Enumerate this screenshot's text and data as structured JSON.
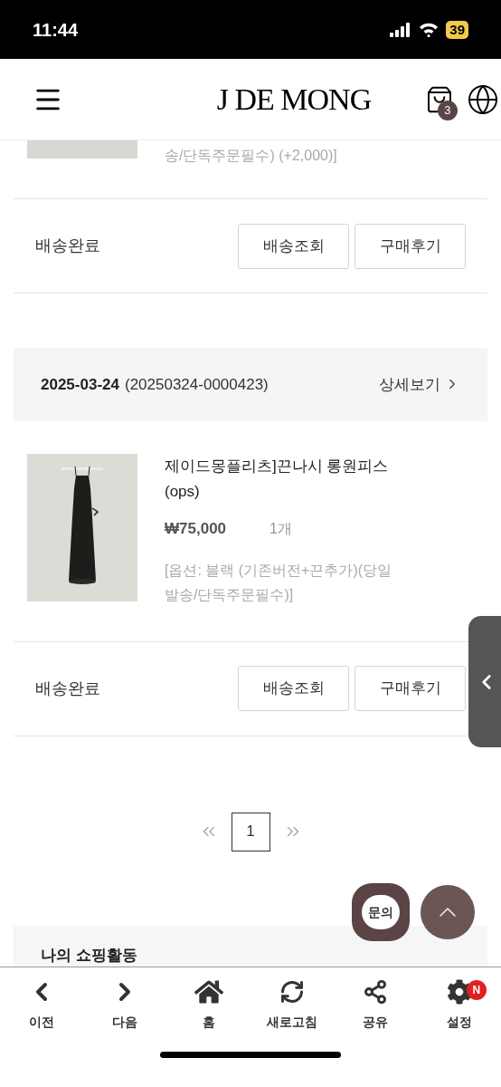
{
  "status_bar": {
    "time": "11:44",
    "battery": "39"
  },
  "header": {
    "logo": "J DE MONG",
    "cart_count": "3"
  },
  "previous_order": {
    "option_tail": "송/단독주문필수) (+2,000)]",
    "status": "배송완료",
    "buttons": [
      "배송조회",
      "구매후기"
    ]
  },
  "order": {
    "date": "2025-03-24",
    "number": "(20250324-0000423)",
    "detail_link": "상세보기",
    "product": {
      "name": "제이드몽플리츠]끈나시 롱원피스 (ops)",
      "price": "₩75,000",
      "quantity": "1개",
      "option": "[옵션: 블랙 (기존버전+끈추가)(당일 발송/단독주문필수)]"
    },
    "status": "배송완료",
    "buttons": [
      "배송조회",
      "구매후기"
    ]
  },
  "pagination": {
    "pages": [
      {
        "label": "1",
        "selected": true
      }
    ]
  },
  "inquiry_button": "문의",
  "section_title": "나의 쇼핑활동",
  "bottom_nav": [
    {
      "label": "이전",
      "kind": "back"
    },
    {
      "label": "다음",
      "kind": "forward"
    },
    {
      "label": "홈",
      "kind": "home"
    },
    {
      "label": "새로고침",
      "kind": "refresh"
    },
    {
      "label": "공유",
      "kind": "share"
    },
    {
      "label": "설정",
      "kind": "settings",
      "badge": "N"
    }
  ]
}
